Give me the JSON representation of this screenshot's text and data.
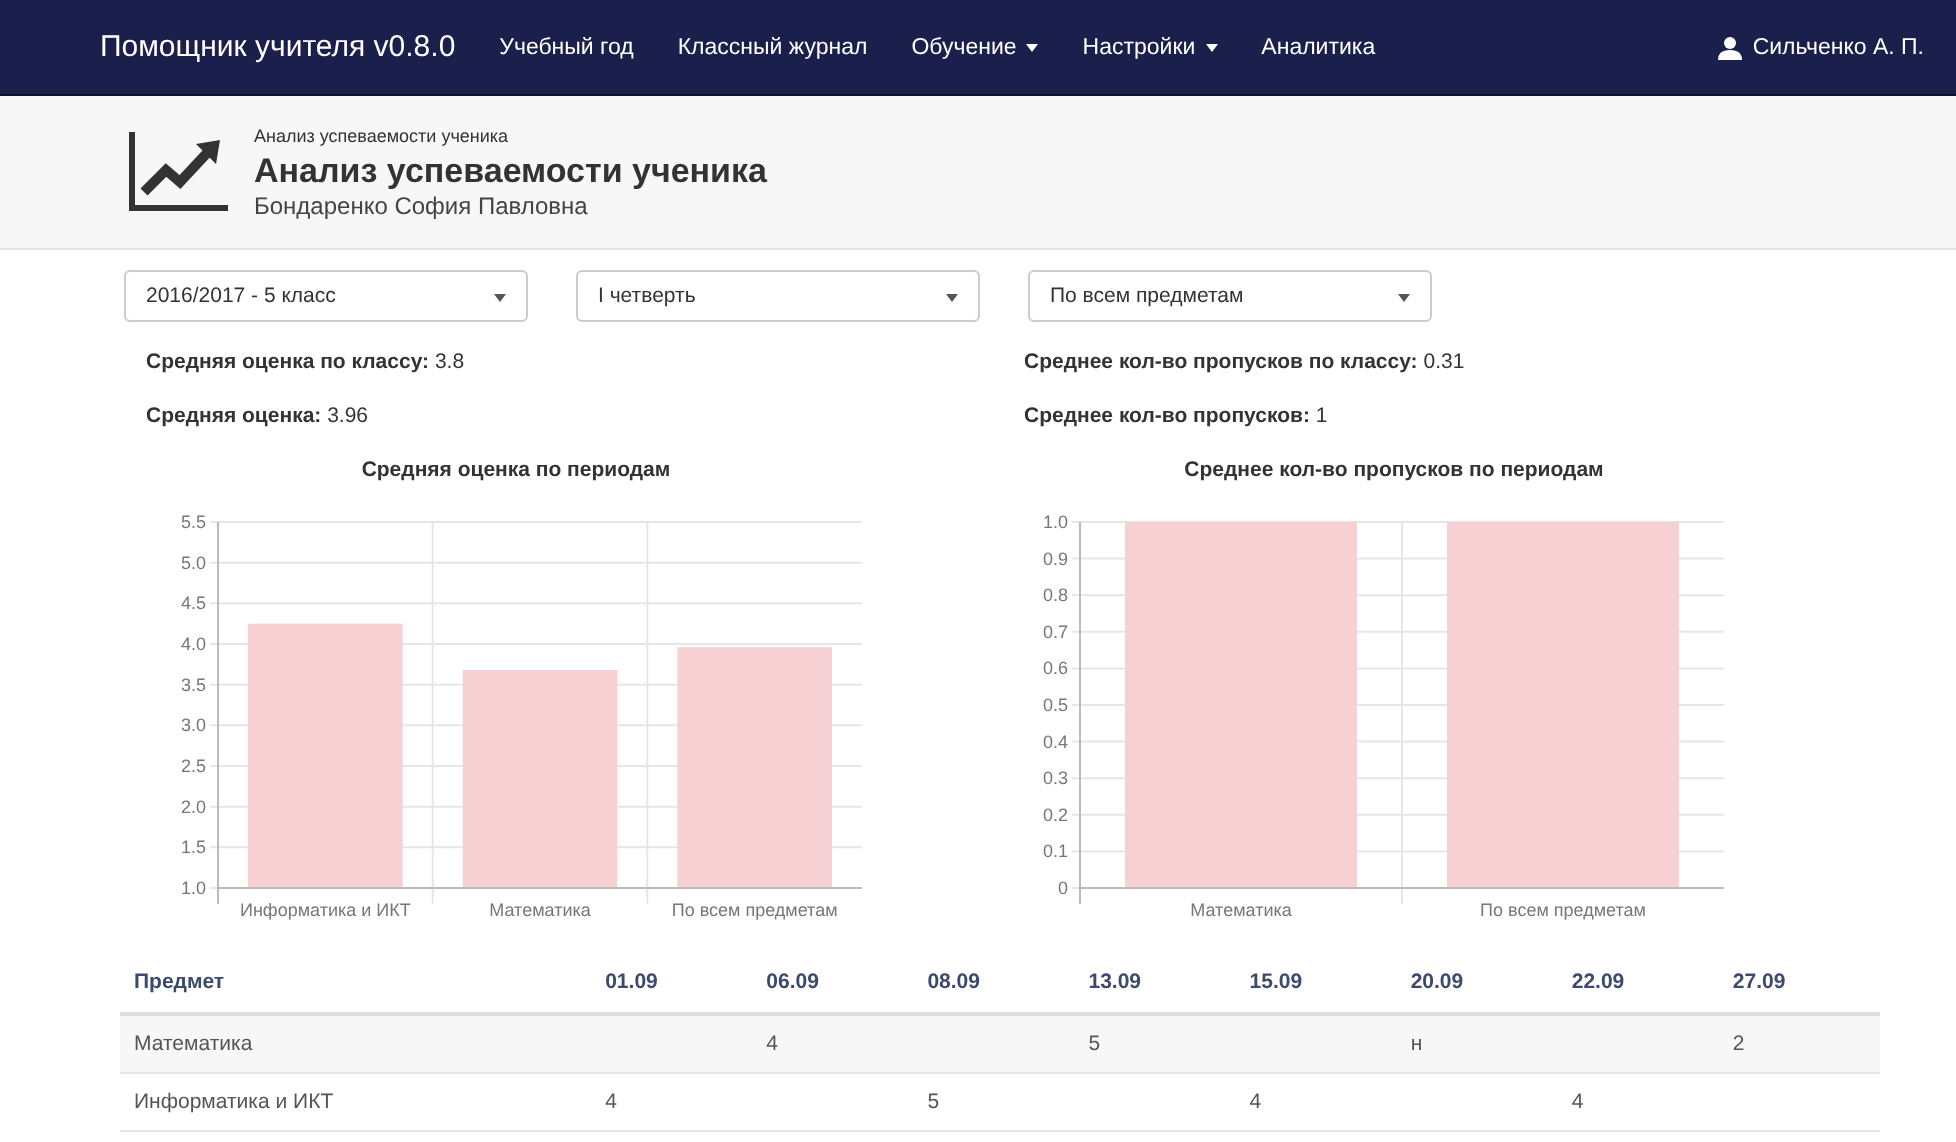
{
  "navbar": {
    "brand": "Помощник учителя v0.8.0",
    "items": [
      {
        "label": "Учебный год",
        "dropdown": false
      },
      {
        "label": "Классный журнал",
        "dropdown": false
      },
      {
        "label": "Обучение",
        "dropdown": true
      },
      {
        "label": "Настройки",
        "dropdown": true
      },
      {
        "label": "Аналитика",
        "dropdown": false
      }
    ],
    "user": "Сильченко А. П."
  },
  "header": {
    "breadcrumb": "Анализ успеваемости ученика",
    "title": "Анализ успеваемости ученика",
    "subtitle": "Бондаренко София Павловна"
  },
  "filters": [
    {
      "value": "2016/2017 - 5 класс"
    },
    {
      "value": "I четверть"
    },
    {
      "value": "По всем предметам"
    }
  ],
  "stats": [
    [
      {
        "label": "Средняя оценка по классу:",
        "value": "3.8"
      },
      {
        "label": "Средняя оценка:",
        "value": "3.96"
      }
    ],
    [
      {
        "label": "Среднее кол-во пропусков по классу:",
        "value": "0.31"
      },
      {
        "label": "Среднее кол-во пропусков:",
        "value": "1"
      }
    ]
  ],
  "charts": [
    {
      "chart_data": {
        "type": "bar",
        "title": "Средняя оценка по периодам",
        "categories": [
          "Информатика и ИКТ",
          "Математика",
          "По всем предметам"
        ],
        "grid": true,
        "series": [
          {
            "color": "#f7d0d3",
            "values": [
              4.25,
              3.68,
              3.96
            ]
          }
        ],
        "ylim": [
          1,
          5.5
        ],
        "yticks": [
          {
            "value": 1,
            "label": "1.0"
          },
          {
            "value": 1.5,
            "label": "1.5"
          },
          {
            "value": 2,
            "label": "2.0"
          },
          {
            "value": 2.5,
            "label": "2.5"
          },
          {
            "value": 3,
            "label": "3.0"
          },
          {
            "value": 3.5,
            "label": "3.5"
          },
          {
            "value": 4,
            "label": "4.0"
          },
          {
            "value": 4.5,
            "label": "4.5"
          },
          {
            "value": 5,
            "label": "5.0"
          },
          {
            "value": 5.5,
            "label": "5.5"
          }
        ]
      }
    },
    {
      "chart_data": {
        "type": "bar",
        "title": "Среднее кол-во пропусков по периодам",
        "categories": [
          "Математика",
          "По всем предметам"
        ],
        "grid": true,
        "series": [
          {
            "color": "#f7d0d3",
            "values": [
              1,
              1
            ]
          }
        ],
        "ylim": [
          0,
          1
        ],
        "yticks": [
          {
            "value": 0,
            "label": "0"
          },
          {
            "value": 0.1,
            "label": "0.1"
          },
          {
            "value": 0.2,
            "label": "0.2"
          },
          {
            "value": 0.3,
            "label": "0.3"
          },
          {
            "value": 0.4,
            "label": "0.4"
          },
          {
            "value": 0.5,
            "label": "0.5"
          },
          {
            "value": 0.6,
            "label": "0.6"
          },
          {
            "value": 0.7,
            "label": "0.7"
          },
          {
            "value": 0.8,
            "label": "0.8"
          },
          {
            "value": 0.9,
            "label": "0.9"
          },
          {
            "value": 1,
            "label": "1.0"
          }
        ]
      }
    }
  ],
  "table": {
    "columns": [
      "Предмет",
      "01.09",
      "06.09",
      "08.09",
      "13.09",
      "15.09",
      "20.09",
      "22.09",
      "27.09"
    ],
    "rows": [
      [
        "Математика",
        "",
        "4",
        "",
        "5",
        "",
        "н",
        "",
        "2"
      ],
      [
        "Информатика и ИКТ",
        "4",
        "",
        "5",
        "",
        "4",
        "",
        "4",
        ""
      ]
    ]
  }
}
